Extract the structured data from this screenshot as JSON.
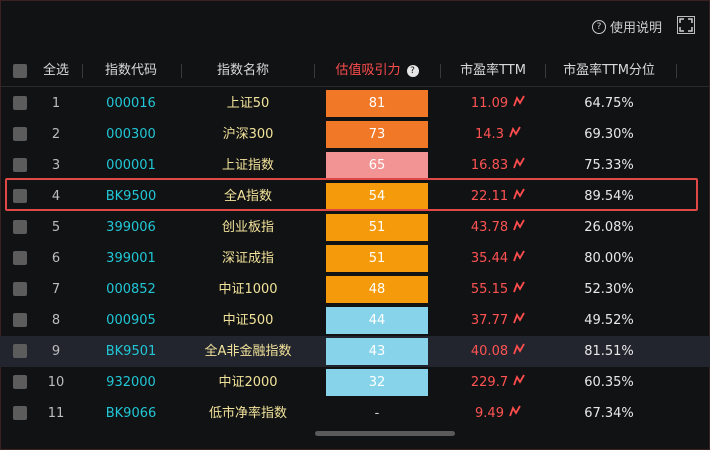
{
  "toolbar": {
    "help_label": "使用说明",
    "help_icon": "question-circle-icon",
    "fullscreen_icon": "fullscreen-icon"
  },
  "table": {
    "columns": [
      "全选",
      "指数代码",
      "指数名称",
      "估值吸引力",
      "市盈率TTM",
      "市盈率TTM分位"
    ],
    "rows": [
      {
        "index": "1",
        "code": "000016",
        "name": "上证50",
        "score": "81",
        "pe": "11.09",
        "pct": "64.75%",
        "color": "#f07826"
      },
      {
        "index": "2",
        "code": "000300",
        "name": "沪深300",
        "score": "73",
        "pe": "14.3",
        "pct": "69.30%",
        "color": "#f07826"
      },
      {
        "index": "3",
        "code": "000001",
        "name": "上证指数",
        "score": "65",
        "pe": "16.83",
        "pct": "75.33%",
        "color": "#f29494"
      },
      {
        "index": "4",
        "code": "BK9500",
        "name": "全A指数",
        "score": "54",
        "pe": "22.11",
        "pct": "89.54%",
        "color": "#f59a0b"
      },
      {
        "index": "5",
        "code": "399006",
        "name": "创业板指",
        "score": "51",
        "pe": "43.78",
        "pct": "26.08%",
        "color": "#f59a0b"
      },
      {
        "index": "6",
        "code": "399001",
        "name": "深证成指",
        "score": "51",
        "pe": "35.44",
        "pct": "80.00%",
        "color": "#f59a0b"
      },
      {
        "index": "7",
        "code": "000852",
        "name": "中证1000",
        "score": "48",
        "pe": "55.15",
        "pct": "52.30%",
        "color": "#f59a0b"
      },
      {
        "index": "8",
        "code": "000905",
        "name": "中证500",
        "score": "44",
        "pe": "37.77",
        "pct": "49.52%",
        "color": "#86d3ea"
      },
      {
        "index": "9",
        "code": "BK9501",
        "name": "全A非金融指数",
        "score": "43",
        "pe": "40.08",
        "pct": "81.51%",
        "color": "#86d3ea"
      },
      {
        "index": "10",
        "code": "932000",
        "name": "中证2000",
        "score": "32",
        "pe": "229.7",
        "pct": "60.35%",
        "color": "#86d3ea"
      },
      {
        "index": "11",
        "code": "BK9066",
        "name": "低市净率指数",
        "score": "-",
        "pe": "9.49",
        "pct": "67.34%",
        "color": ""
      }
    ]
  }
}
